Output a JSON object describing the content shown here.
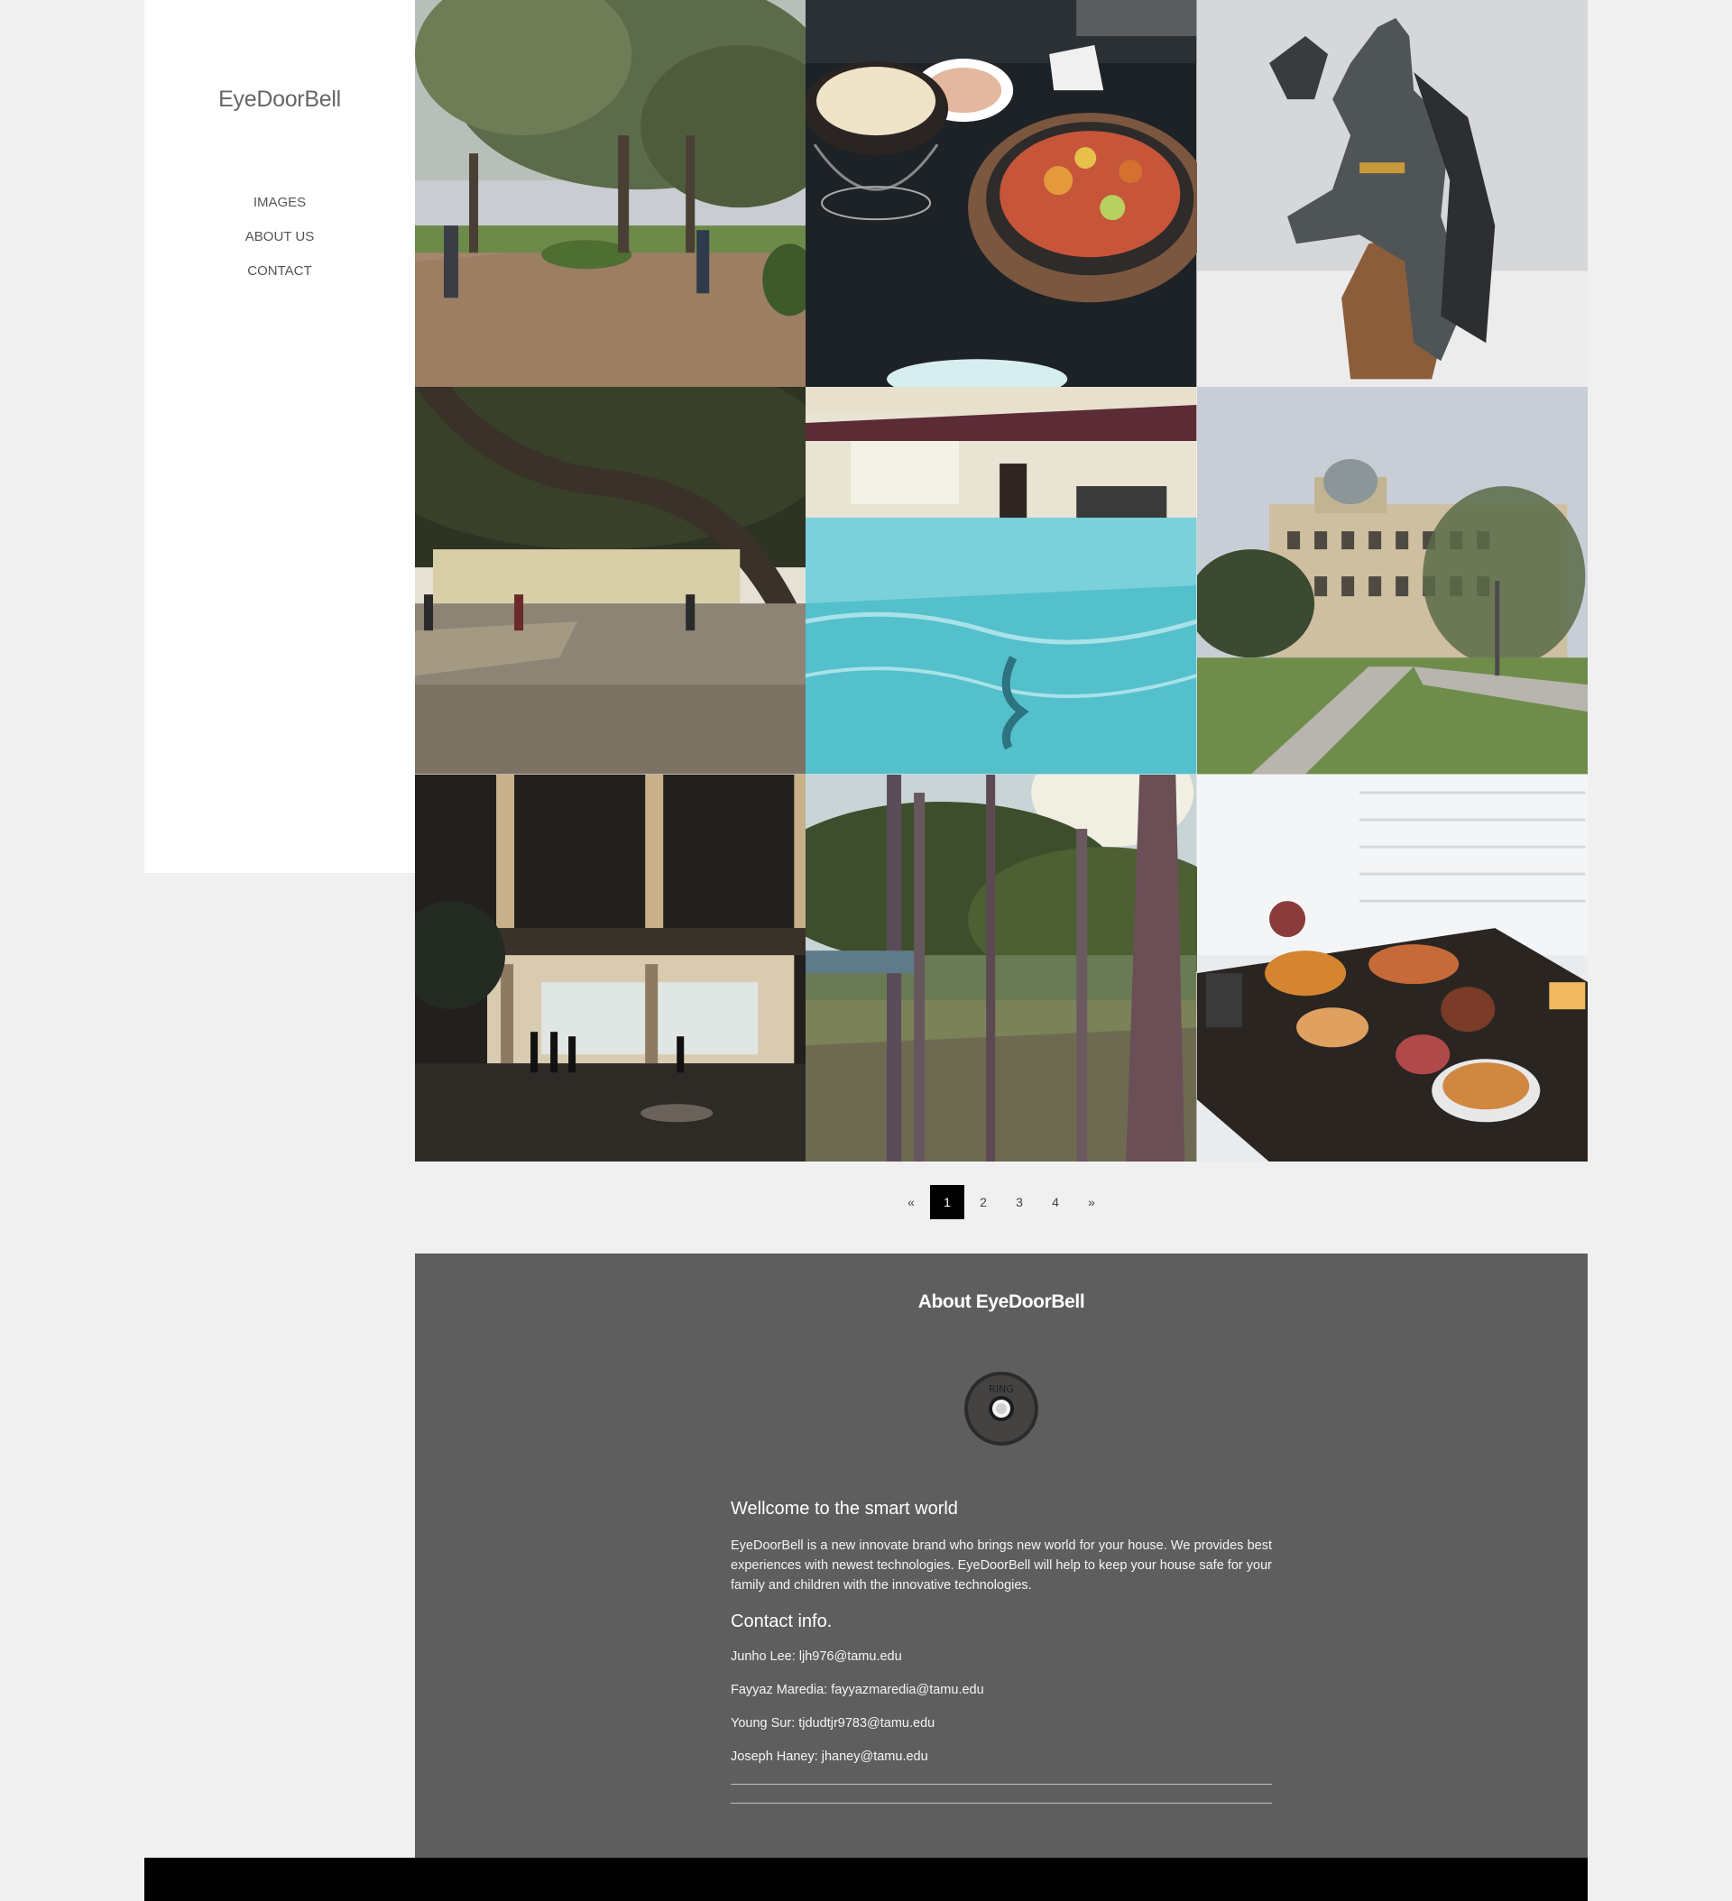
{
  "sidebar": {
    "logo": "EyeDoorBell",
    "nav": [
      "IMAGES",
      "ABOUT US",
      "CONTACT"
    ]
  },
  "gallery": {
    "images": [
      {
        "name": "campus-walkway-trees-photo"
      },
      {
        "name": "food-dishes-table-photo"
      },
      {
        "name": "batman-figurine-photo"
      },
      {
        "name": "campus-oak-tree-photo"
      },
      {
        "name": "indoor-pool-photo"
      },
      {
        "name": "academic-building-dome-photo"
      },
      {
        "name": "building-night-entrance-photo"
      },
      {
        "name": "pine-forest-sunlight-photo"
      },
      {
        "name": "thanksgiving-dinner-table-photo"
      }
    ]
  },
  "pagination": {
    "prev": "«",
    "pages": [
      "1",
      "2",
      "3",
      "4"
    ],
    "next": "»",
    "current": "1"
  },
  "about": {
    "title": "About EyeDoorBell",
    "bell_icon": "doorbell-icon",
    "bell_text": "RING",
    "welcome_heading": "Wellcome to the smart world",
    "description": "EyeDoorBell is a new innovate brand who brings new world for your house. We provides best experiences with newest technologies. EyeDoorBell will help to keep your house safe for your family and children with the innovative technologies.",
    "contact_heading": "Contact info.",
    "contacts": [
      "Junho Lee: ljh976@tamu.edu",
      "Fayyaz Maredia: fayyazmaredia@tamu.edu",
      "Young Sur: tjdudtjr9783@tamu.edu",
      "Joseph Haney: jhaney@tamu.edu"
    ]
  },
  "colors": {
    "page_bg": "#f0f0f0",
    "sidebar_bg": "#ffffff",
    "about_bg": "#5e5e5e",
    "footer_bg": "#000000",
    "active_page": "#000000"
  }
}
